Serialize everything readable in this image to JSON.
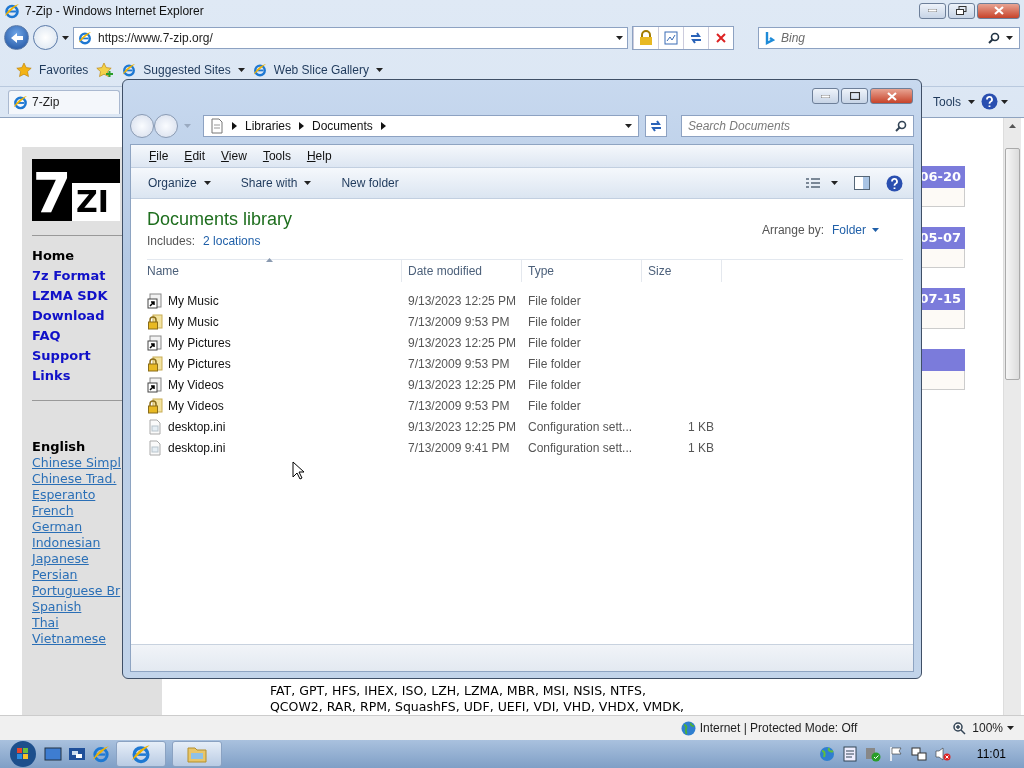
{
  "ie": {
    "title": "7-Zip - Windows Internet Explorer",
    "address": "https://www.7-zip.org/",
    "search_placeholder": "Bing",
    "favorites": "Favorites",
    "fav_links": [
      "Suggested Sites",
      "Web Slice Gallery"
    ],
    "tab": "7-Zip",
    "tools": "Tools"
  },
  "page": {
    "logo": {
      "digit": "7",
      "letters": "ZI"
    },
    "nav": [
      {
        "label": "Home",
        "selected": true
      },
      {
        "label": "7z Format",
        "selected": false
      },
      {
        "label": "LZMA SDK",
        "selected": false
      },
      {
        "label": "Download",
        "selected": false
      },
      {
        "label": "FAQ",
        "selected": false
      },
      {
        "label": "Support",
        "selected": false
      },
      {
        "label": "Links",
        "selected": false
      }
    ],
    "languages": [
      {
        "label": "English",
        "selected": true
      },
      {
        "label": "Chinese Simpl",
        "selected": false
      },
      {
        "label": "Chinese Trad.",
        "selected": false
      },
      {
        "label": "Esperanto",
        "selected": false
      },
      {
        "label": "French",
        "selected": false
      },
      {
        "label": "German",
        "selected": false
      },
      {
        "label": "Indonesian",
        "selected": false
      },
      {
        "label": "Japanese",
        "selected": false
      },
      {
        "label": "Persian",
        "selected": false
      },
      {
        "label": "Portuguese Br",
        "selected": false
      },
      {
        "label": "Spanish",
        "selected": false
      },
      {
        "label": "Thai",
        "selected": false
      },
      {
        "label": "Vietnamese",
        "selected": false
      }
    ],
    "news": [
      {
        "kind": "dated",
        "date": "06-20"
      },
      {
        "kind": "dated",
        "date": "05-07"
      },
      {
        "kind": "dated",
        "date": "07-15"
      },
      {
        "kind": "blank"
      }
    ],
    "format_lines": [
      "FAT, GPT, HFS, IHEX, ISO, LZH, LZMA, MBR, MSI, NSIS, NTFS,",
      "QCOW2, RAR, RPM, SquashFS, UDF, UEFI, VDI, VHD, VHDX, VMDK,"
    ]
  },
  "status_bar": {
    "zone": "Internet | Protected Mode: Off",
    "zoom": "100%"
  },
  "explorer": {
    "breadcrumb": [
      "Libraries",
      "Documents"
    ],
    "search_placeholder": "Search Documents",
    "menu": [
      "File",
      "Edit",
      "View",
      "Tools",
      "Help"
    ],
    "toolbar": [
      {
        "label": "Organize",
        "dropdown": true
      },
      {
        "label": "Share with",
        "dropdown": true
      },
      {
        "label": "New folder",
        "dropdown": false
      }
    ],
    "library_title": "Documents library",
    "includes_label": "Includes:",
    "includes_link": "2 locations",
    "arrange_label": "Arrange by:",
    "arrange_value": "Folder",
    "columns": [
      "Name",
      "Date modified",
      "Type",
      "Size"
    ],
    "rows": [
      {
        "kind": "shortcut",
        "name": "My Music",
        "date": "9/13/2023 12:25 PM",
        "type": "File folder"
      },
      {
        "kind": "locked",
        "name": "My Music",
        "date": "7/13/2009 9:53 PM",
        "type": "File folder"
      },
      {
        "kind": "shortcut",
        "name": "My Pictures",
        "date": "9/13/2023 12:25 PM",
        "type": "File folder"
      },
      {
        "kind": "locked",
        "name": "My Pictures",
        "date": "7/13/2009 9:53 PM",
        "type": "File folder"
      },
      {
        "kind": "shortcut",
        "name": "My Videos",
        "date": "9/13/2023 12:25 PM",
        "type": "File folder"
      },
      {
        "kind": "locked",
        "name": "My Videos",
        "date": "7/13/2009 9:53 PM",
        "type": "File folder"
      },
      {
        "kind": "file",
        "name": "desktop.ini",
        "date": "9/13/2023 12:25 PM",
        "type": "Configuration sett...",
        "size": "1 KB"
      },
      {
        "kind": "file",
        "name": "desktop.ini",
        "date": "7/13/2009 9:41 PM",
        "type": "Configuration sett...",
        "size": "1 KB"
      }
    ]
  },
  "taskbar": {
    "apps": [
      {
        "kind": "browser"
      },
      {
        "kind": "explorer"
      }
    ],
    "clock": "11:01"
  }
}
